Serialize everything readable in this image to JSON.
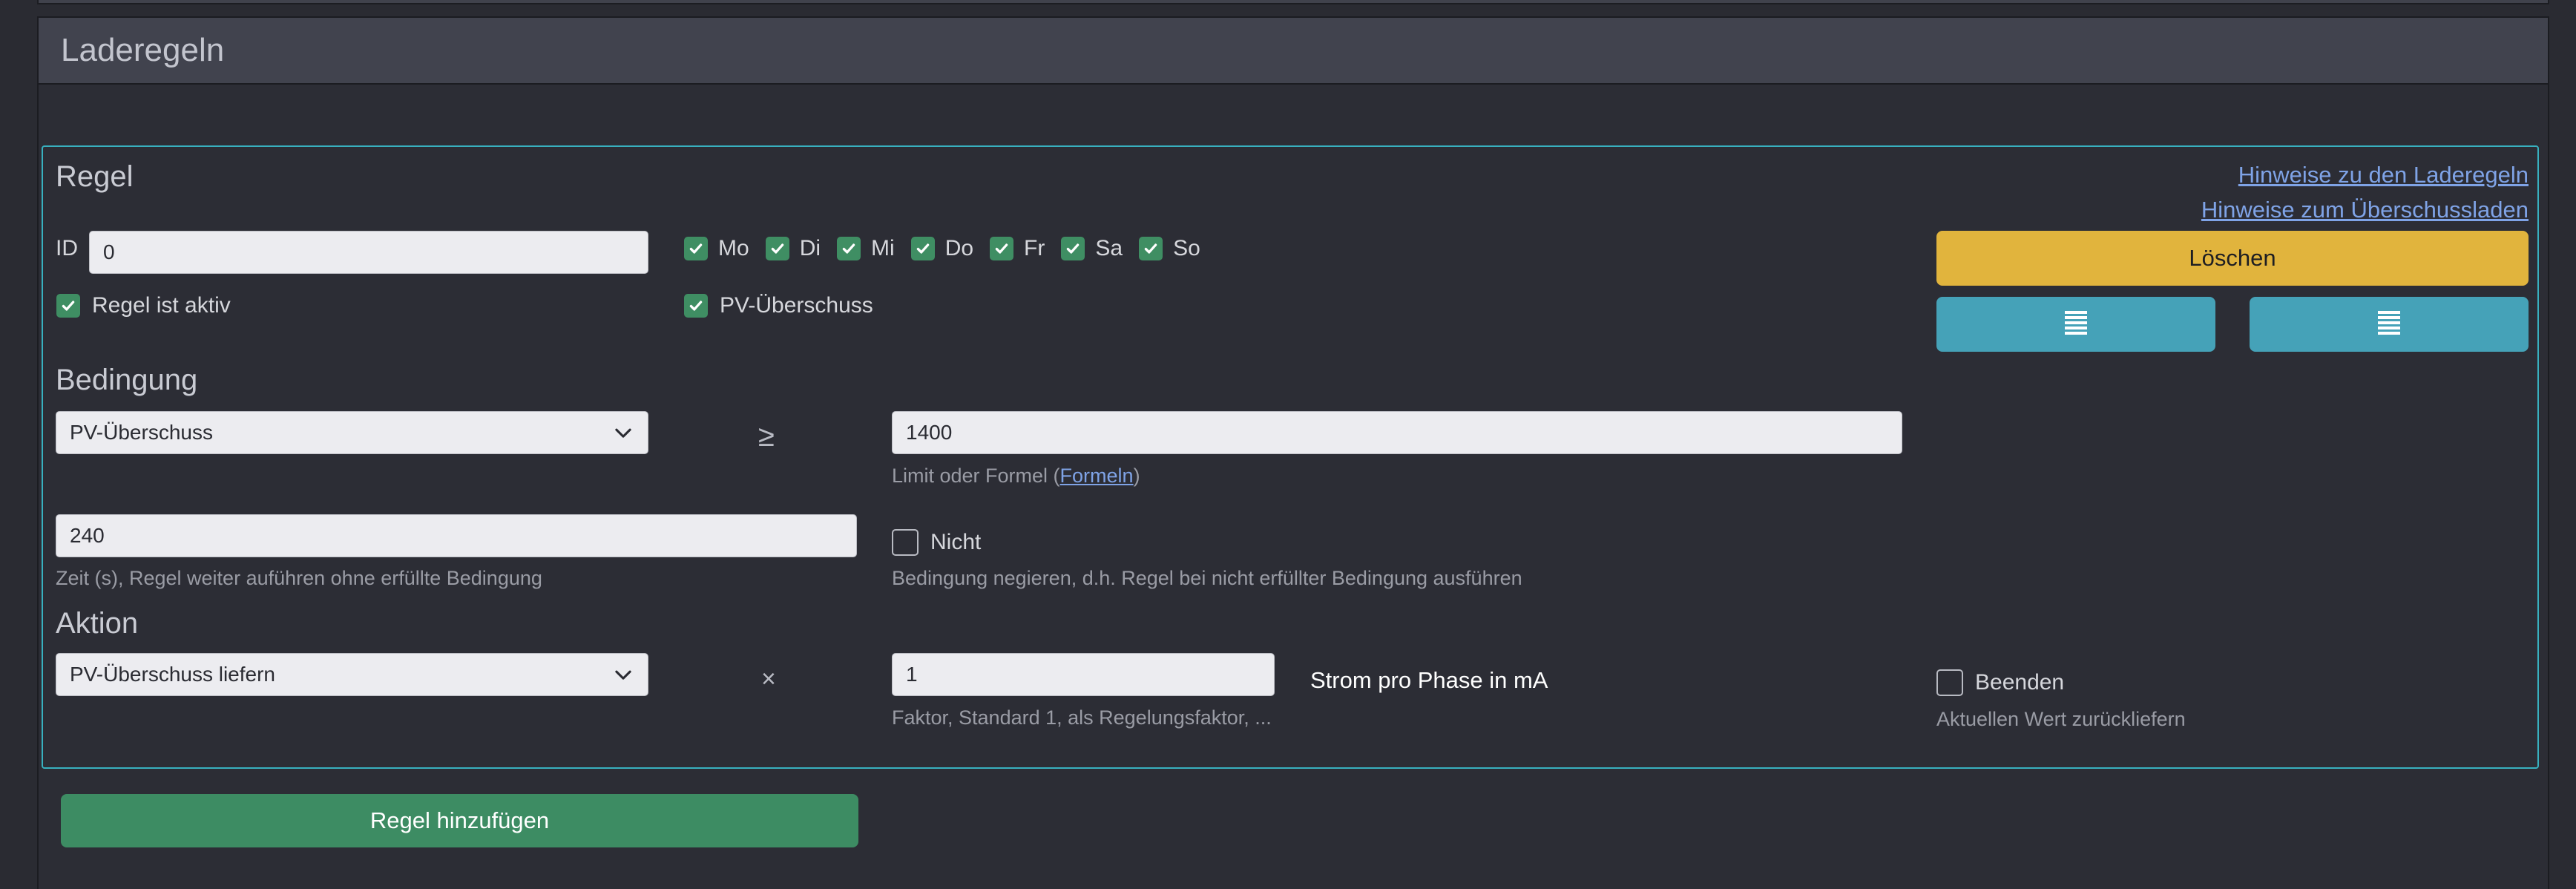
{
  "card": {
    "title": "Laderegeln"
  },
  "rule": {
    "title": "Regel",
    "links": {
      "hint_rules": "Hinweise zu den Laderegeln",
      "hint_surplus": "Hinweise zum Überschussladen"
    },
    "id_label": "ID",
    "id_value": "0",
    "active_label": "Regel ist aktiv",
    "days": [
      {
        "label": "Mo",
        "checked": true
      },
      {
        "label": "Di",
        "checked": true
      },
      {
        "label": "Mi",
        "checked": true
      },
      {
        "label": "Do",
        "checked": true
      },
      {
        "label": "Fr",
        "checked": true
      },
      {
        "label": "Sa",
        "checked": true
      },
      {
        "label": "So",
        "checked": true
      }
    ],
    "pv_label": "PV-Überschuss",
    "delete_label": "Löschen",
    "move_icons": [
      "list-icon",
      "list-icon"
    ]
  },
  "condition": {
    "heading": "Bedingung",
    "select_value": "PV-Überschuss",
    "operator": "≥",
    "limit_value": "1400",
    "limit_hint_prefix": "Limit oder Formel (",
    "limit_hint_link": "Formeln",
    "limit_hint_suffix": ")",
    "time_value": "240",
    "time_hint": "Zeit (s), Regel weiter auführen ohne erfüllte Bedingung",
    "not_label": "Nicht",
    "not_hint": "Bedingung negieren, d.h. Regel bei nicht erfüllter Bedingung ausführen"
  },
  "action": {
    "heading": "Aktion",
    "select_value": "PV-Überschuss liefern",
    "operator": "×",
    "factor_value": "1",
    "factor_hint": "Faktor, Standard 1, als Regelungsfaktor, ...",
    "unit_label": "Strom pro Phase in mA",
    "end_label": "Beenden",
    "end_hint": "Aktuellen Wert zurückliefern"
  },
  "add_rule_label": "Regel hinzufügen",
  "colors": {
    "accent_border": "#38b0bf",
    "warning": "#e1b43d",
    "info": "#45a2b8",
    "success": "#3d8c63"
  }
}
